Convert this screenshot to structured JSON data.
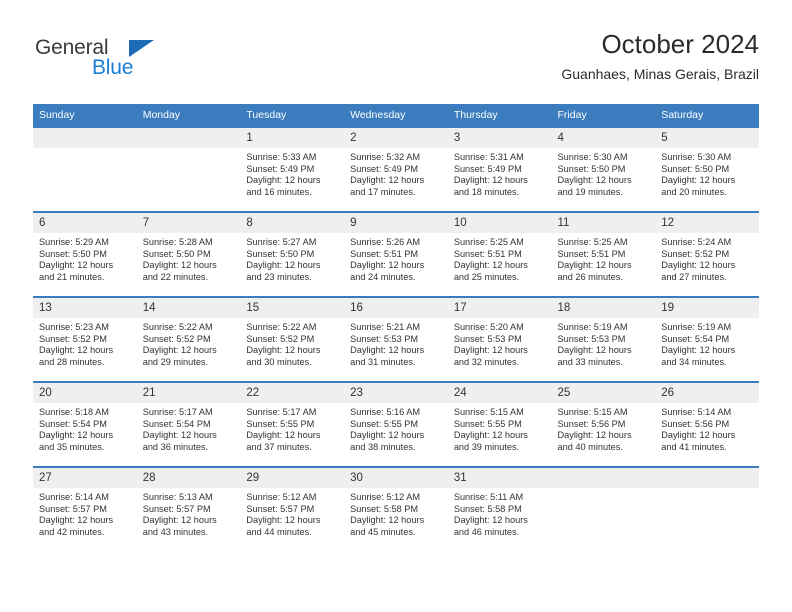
{
  "logo": {
    "word_one": "General",
    "word_two": "Blue",
    "triangle_color": "#1c6cb5",
    "blue_color": "#1c7fd6",
    "general_color": "#3b3b3b"
  },
  "header": {
    "title": "October 2024",
    "subtitle": "Guanhaes, Minas Gerais, Brazil"
  },
  "theme": {
    "header_blue": "#3a7cbe",
    "daynum_gray": "#efefef",
    "text": "#333333"
  },
  "weekday_headers": [
    "Sunday",
    "Monday",
    "Tuesday",
    "Wednesday",
    "Thursday",
    "Friday",
    "Saturday"
  ],
  "weeks": [
    [
      {
        "day": "",
        "sunrise": "",
        "sunset": "",
        "daylight_line1": "",
        "daylight_line2": ""
      },
      {
        "day": "",
        "sunrise": "",
        "sunset": "",
        "daylight_line1": "",
        "daylight_line2": ""
      },
      {
        "day": "1",
        "sunrise": "Sunrise: 5:33 AM",
        "sunset": "Sunset: 5:49 PM",
        "daylight_line1": "Daylight: 12 hours",
        "daylight_line2": "and 16 minutes."
      },
      {
        "day": "2",
        "sunrise": "Sunrise: 5:32 AM",
        "sunset": "Sunset: 5:49 PM",
        "daylight_line1": "Daylight: 12 hours",
        "daylight_line2": "and 17 minutes."
      },
      {
        "day": "3",
        "sunrise": "Sunrise: 5:31 AM",
        "sunset": "Sunset: 5:49 PM",
        "daylight_line1": "Daylight: 12 hours",
        "daylight_line2": "and 18 minutes."
      },
      {
        "day": "4",
        "sunrise": "Sunrise: 5:30 AM",
        "sunset": "Sunset: 5:50 PM",
        "daylight_line1": "Daylight: 12 hours",
        "daylight_line2": "and 19 minutes."
      },
      {
        "day": "5",
        "sunrise": "Sunrise: 5:30 AM",
        "sunset": "Sunset: 5:50 PM",
        "daylight_line1": "Daylight: 12 hours",
        "daylight_line2": "and 20 minutes."
      }
    ],
    [
      {
        "day": "6",
        "sunrise": "Sunrise: 5:29 AM",
        "sunset": "Sunset: 5:50 PM",
        "daylight_line1": "Daylight: 12 hours",
        "daylight_line2": "and 21 minutes."
      },
      {
        "day": "7",
        "sunrise": "Sunrise: 5:28 AM",
        "sunset": "Sunset: 5:50 PM",
        "daylight_line1": "Daylight: 12 hours",
        "daylight_line2": "and 22 minutes."
      },
      {
        "day": "8",
        "sunrise": "Sunrise: 5:27 AM",
        "sunset": "Sunset: 5:50 PM",
        "daylight_line1": "Daylight: 12 hours",
        "daylight_line2": "and 23 minutes."
      },
      {
        "day": "9",
        "sunrise": "Sunrise: 5:26 AM",
        "sunset": "Sunset: 5:51 PM",
        "daylight_line1": "Daylight: 12 hours",
        "daylight_line2": "and 24 minutes."
      },
      {
        "day": "10",
        "sunrise": "Sunrise: 5:25 AM",
        "sunset": "Sunset: 5:51 PM",
        "daylight_line1": "Daylight: 12 hours",
        "daylight_line2": "and 25 minutes."
      },
      {
        "day": "11",
        "sunrise": "Sunrise: 5:25 AM",
        "sunset": "Sunset: 5:51 PM",
        "daylight_line1": "Daylight: 12 hours",
        "daylight_line2": "and 26 minutes."
      },
      {
        "day": "12",
        "sunrise": "Sunrise: 5:24 AM",
        "sunset": "Sunset: 5:52 PM",
        "daylight_line1": "Daylight: 12 hours",
        "daylight_line2": "and 27 minutes."
      }
    ],
    [
      {
        "day": "13",
        "sunrise": "Sunrise: 5:23 AM",
        "sunset": "Sunset: 5:52 PM",
        "daylight_line1": "Daylight: 12 hours",
        "daylight_line2": "and 28 minutes."
      },
      {
        "day": "14",
        "sunrise": "Sunrise: 5:22 AM",
        "sunset": "Sunset: 5:52 PM",
        "daylight_line1": "Daylight: 12 hours",
        "daylight_line2": "and 29 minutes."
      },
      {
        "day": "15",
        "sunrise": "Sunrise: 5:22 AM",
        "sunset": "Sunset: 5:52 PM",
        "daylight_line1": "Daylight: 12 hours",
        "daylight_line2": "and 30 minutes."
      },
      {
        "day": "16",
        "sunrise": "Sunrise: 5:21 AM",
        "sunset": "Sunset: 5:53 PM",
        "daylight_line1": "Daylight: 12 hours",
        "daylight_line2": "and 31 minutes."
      },
      {
        "day": "17",
        "sunrise": "Sunrise: 5:20 AM",
        "sunset": "Sunset: 5:53 PM",
        "daylight_line1": "Daylight: 12 hours",
        "daylight_line2": "and 32 minutes."
      },
      {
        "day": "18",
        "sunrise": "Sunrise: 5:19 AM",
        "sunset": "Sunset: 5:53 PM",
        "daylight_line1": "Daylight: 12 hours",
        "daylight_line2": "and 33 minutes."
      },
      {
        "day": "19",
        "sunrise": "Sunrise: 5:19 AM",
        "sunset": "Sunset: 5:54 PM",
        "daylight_line1": "Daylight: 12 hours",
        "daylight_line2": "and 34 minutes."
      }
    ],
    [
      {
        "day": "20",
        "sunrise": "Sunrise: 5:18 AM",
        "sunset": "Sunset: 5:54 PM",
        "daylight_line1": "Daylight: 12 hours",
        "daylight_line2": "and 35 minutes."
      },
      {
        "day": "21",
        "sunrise": "Sunrise: 5:17 AM",
        "sunset": "Sunset: 5:54 PM",
        "daylight_line1": "Daylight: 12 hours",
        "daylight_line2": "and 36 minutes."
      },
      {
        "day": "22",
        "sunrise": "Sunrise: 5:17 AM",
        "sunset": "Sunset: 5:55 PM",
        "daylight_line1": "Daylight: 12 hours",
        "daylight_line2": "and 37 minutes."
      },
      {
        "day": "23",
        "sunrise": "Sunrise: 5:16 AM",
        "sunset": "Sunset: 5:55 PM",
        "daylight_line1": "Daylight: 12 hours",
        "daylight_line2": "and 38 minutes."
      },
      {
        "day": "24",
        "sunrise": "Sunrise: 5:15 AM",
        "sunset": "Sunset: 5:55 PM",
        "daylight_line1": "Daylight: 12 hours",
        "daylight_line2": "and 39 minutes."
      },
      {
        "day": "25",
        "sunrise": "Sunrise: 5:15 AM",
        "sunset": "Sunset: 5:56 PM",
        "daylight_line1": "Daylight: 12 hours",
        "daylight_line2": "and 40 minutes."
      },
      {
        "day": "26",
        "sunrise": "Sunrise: 5:14 AM",
        "sunset": "Sunset: 5:56 PM",
        "daylight_line1": "Daylight: 12 hours",
        "daylight_line2": "and 41 minutes."
      }
    ],
    [
      {
        "day": "27",
        "sunrise": "Sunrise: 5:14 AM",
        "sunset": "Sunset: 5:57 PM",
        "daylight_line1": "Daylight: 12 hours",
        "daylight_line2": "and 42 minutes."
      },
      {
        "day": "28",
        "sunrise": "Sunrise: 5:13 AM",
        "sunset": "Sunset: 5:57 PM",
        "daylight_line1": "Daylight: 12 hours",
        "daylight_line2": "and 43 minutes."
      },
      {
        "day": "29",
        "sunrise": "Sunrise: 5:12 AM",
        "sunset": "Sunset: 5:57 PM",
        "daylight_line1": "Daylight: 12 hours",
        "daylight_line2": "and 44 minutes."
      },
      {
        "day": "30",
        "sunrise": "Sunrise: 5:12 AM",
        "sunset": "Sunset: 5:58 PM",
        "daylight_line1": "Daylight: 12 hours",
        "daylight_line2": "and 45 minutes."
      },
      {
        "day": "31",
        "sunrise": "Sunrise: 5:11 AM",
        "sunset": "Sunset: 5:58 PM",
        "daylight_line1": "Daylight: 12 hours",
        "daylight_line2": "and 46 minutes."
      },
      {
        "day": "",
        "sunrise": "",
        "sunset": "",
        "daylight_line1": "",
        "daylight_line2": ""
      },
      {
        "day": "",
        "sunrise": "",
        "sunset": "",
        "daylight_line1": "",
        "daylight_line2": ""
      }
    ]
  ]
}
